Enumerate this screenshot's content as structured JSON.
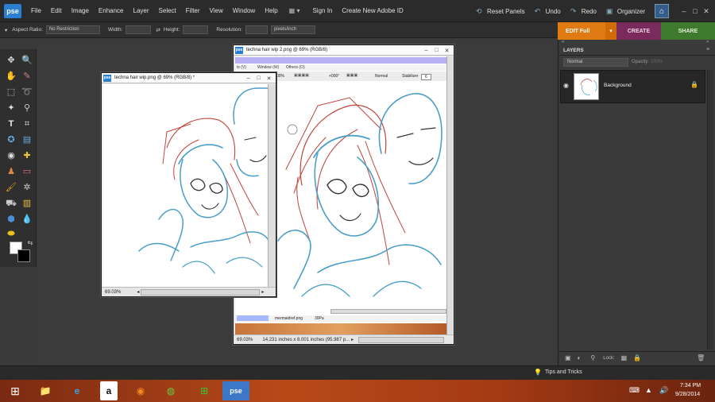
{
  "app": {
    "logo": "pse",
    "menu": [
      "File",
      "Edit",
      "Image",
      "Enhance",
      "Layer",
      "Select",
      "Filter",
      "View",
      "Window",
      "Help"
    ],
    "sign_in": "Sign In",
    "create_id": "Create New Adobe ID",
    "reset_panels": "Reset Panels",
    "undo": "Undo",
    "redo": "Redo",
    "organizer": "Organizer"
  },
  "options": {
    "aspect_label": "Aspect Ratio:",
    "aspect_value": "No Restriction",
    "width_label": "Width:",
    "height_label": "Height:",
    "resolution_label": "Resolution:",
    "resolution_unit": "pixels/inch"
  },
  "modes": {
    "edit": "EDIT Full",
    "create": "CREATE",
    "share": "SHARE"
  },
  "colors": {
    "accent_edit": "#e07a12",
    "create": "#7a2a5c",
    "share": "#3e7a2e",
    "stroke_blue": "#4a9fc8",
    "stroke_red": "#c0443c"
  },
  "doc1": {
    "title": "techna hair wip.png @ 69% (RGB/8) *",
    "zoom": "69.03%"
  },
  "doc2": {
    "title": "techna hair wip 2.png @ 69% (RGB/8)",
    "zoom": "69.03%",
    "dims": "14.231 inches x 8.001 inches (95.987 p...",
    "inner_menu": [
      "Window (W)",
      "Others (O)"
    ],
    "inner_zoom": "+000°",
    "inner_mode": "Normal",
    "inner_stabilizer": "Stabilizer",
    "inner_stab_value": "6",
    "inner_tab": "mermaidref.png",
    "inner_pct": "39Pa",
    "inner_left": "00%"
  },
  "layers": {
    "header": "LAYERS",
    "blend": "Normal",
    "opacity": "Opacity:",
    "opacity_value": "100%",
    "layer_name": "Background",
    "lock_label": "Lock:"
  },
  "tips": "Tips and Tricks",
  "clock": {
    "time": "7:34 PM",
    "date": "9/28/2014"
  }
}
